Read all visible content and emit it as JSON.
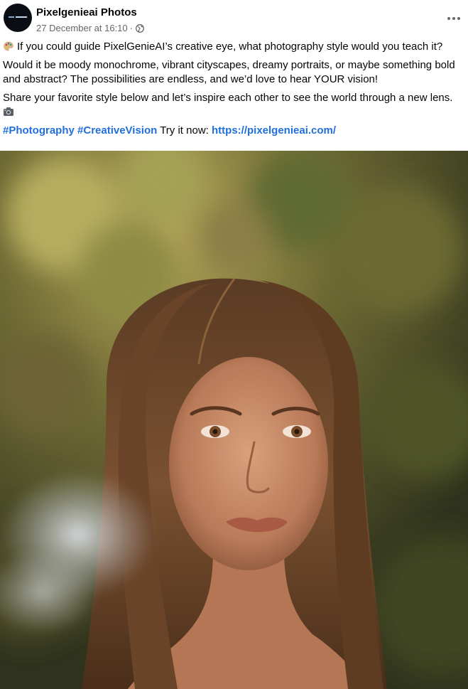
{
  "post": {
    "page_name": "Pixelgenieai Photos",
    "timestamp": "27 December at 16:10",
    "separator": "·",
    "audience_icon": "globe-icon",
    "more_icon": "more-options-icon",
    "paragraph1_emoji": "palette-icon",
    "paragraph1": "If you could guide PixelGenieAI’s creative eye, what photography style would you teach it?",
    "paragraph2": "Would it be moody monochrome, vibrant cityscapes, dreamy portraits, or maybe something bold and abstract? The possibilities are endless, and we’d love to hear YOUR vision!",
    "paragraph3": "Share your favorite style below and let’s inspire each other to see the world through a new lens.",
    "paragraph3_emoji": "camera-icon",
    "hashtags": [
      "#Photography",
      "#CreativeVision"
    ],
    "cta_text": "Try it now:",
    "link": "https://pixelgenieai.com/"
  },
  "colors": {
    "link": "#216fdb",
    "meta_text": "#65676b",
    "text": "#050505"
  }
}
